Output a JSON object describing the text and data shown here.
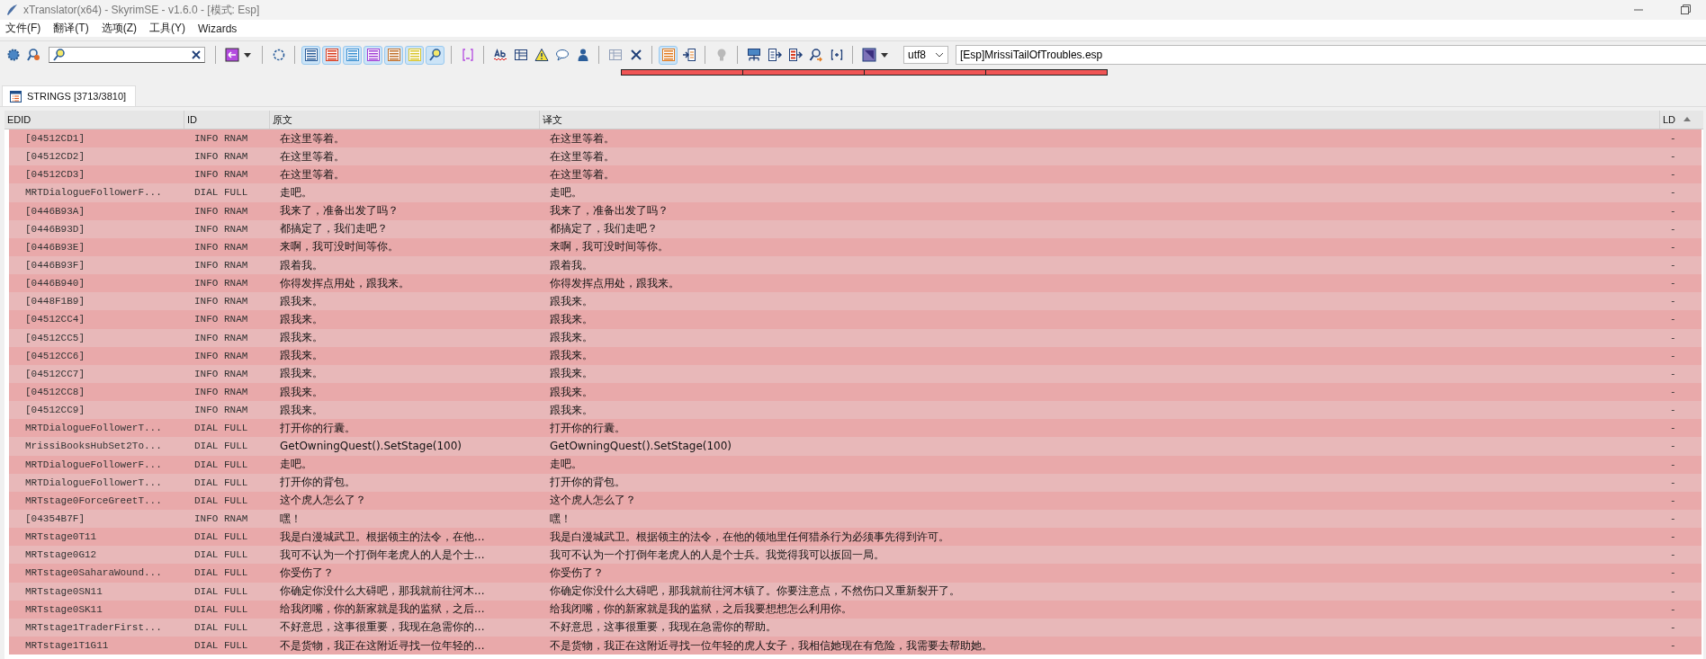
{
  "window": {
    "title": "xTranslator(x64) - SkyrimSE - v1.6.0 - [模式: Esp]"
  },
  "menu": [
    "文件(F)",
    "翻译(T)",
    "选项(Z)",
    "工具(Y)",
    "Wizards"
  ],
  "toolbar": [
    {
      "kind": "gear"
    },
    {
      "kind": "find"
    },
    {
      "kind": "search"
    },
    {
      "kind": "sep"
    },
    {
      "kind": "back"
    },
    {
      "kind": "caret"
    },
    {
      "kind": "sep"
    },
    {
      "kind": "ring"
    },
    {
      "kind": "sep"
    },
    {
      "kind": "list",
      "color": "#2a5d9a",
      "pressed": true
    },
    {
      "kind": "list",
      "color": "#d8391c",
      "pressed": true
    },
    {
      "kind": "list",
      "color": "#3a8fd0",
      "pressed": true
    },
    {
      "kind": "list",
      "color": "#a13fd6",
      "pressed": true
    },
    {
      "kind": "list",
      "color": "#c0702a",
      "pressed": true
    },
    {
      "kind": "list",
      "color": "#d9c62c",
      "pressed": true
    },
    {
      "kind": "lens",
      "pressed": true
    },
    {
      "kind": "sep"
    },
    {
      "kind": "brackets"
    },
    {
      "kind": "sep"
    },
    {
      "kind": "spell"
    },
    {
      "kind": "table"
    },
    {
      "kind": "warning"
    },
    {
      "kind": "bubble"
    },
    {
      "kind": "person"
    },
    {
      "kind": "sep"
    },
    {
      "kind": "table",
      "disabled": true
    },
    {
      "kind": "cross"
    },
    {
      "kind": "sep"
    },
    {
      "kind": "list",
      "color": "#e07a1f",
      "pressed": true
    },
    {
      "kind": "import"
    },
    {
      "kind": "sep"
    },
    {
      "kind": "bulb",
      "disabled": true
    },
    {
      "kind": "sep"
    },
    {
      "kind": "network"
    },
    {
      "kind": "export"
    },
    {
      "kind": "export2"
    },
    {
      "kind": "findnext"
    },
    {
      "kind": "plus"
    },
    {
      "kind": "sep"
    },
    {
      "kind": "square"
    },
    {
      "kind": "caret"
    },
    {
      "kind": "select",
      "value": "utf8"
    },
    {
      "kind": "file",
      "value": "[Esp]MrissiTailOfTroubles.esp"
    }
  ],
  "progress": [
    {
      "level": 1
    },
    {
      "level": 1
    },
    {
      "level": 1
    },
    {
      "level": 1
    }
  ],
  "tabs": [
    {
      "label": "STRINGS [3713/3810]",
      "selected": true
    }
  ],
  "table": {
    "columns": [
      "EDID",
      "ID",
      "原文",
      "译文",
      "LD"
    ],
    "rows": [
      [
        "[04512CD1]",
        "INFO RNAM",
        "在这里等着。",
        "在这里等着。",
        "-"
      ],
      [
        "[04512CD2]",
        "INFO RNAM",
        "在这里等着。",
        "在这里等着。",
        "-"
      ],
      [
        "[04512CD3]",
        "INFO RNAM",
        "在这里等着。",
        "在这里等着。",
        "-"
      ],
      [
        "MRTDialogueFollowerF...",
        "DIAL FULL",
        "走吧。",
        "走吧。",
        "-"
      ],
      [
        "[0446B93A]",
        "INFO RNAM",
        "我来了，准备出发了吗？",
        "我来了，准备出发了吗？",
        "-"
      ],
      [
        "[0446B93D]",
        "INFO RNAM",
        "都搞定了，我们走吧？",
        "都搞定了，我们走吧？",
        "-"
      ],
      [
        "[0446B93E]",
        "INFO RNAM",
        "来啊，我可没时间等你。",
        "来啊，我可没时间等你。",
        "-"
      ],
      [
        "[0446B93F]",
        "INFO RNAM",
        "跟着我。",
        "跟着我。",
        "-"
      ],
      [
        "[0446B940]",
        "INFO RNAM",
        "你得发挥点用处，跟我来。",
        "你得发挥点用处，跟我来。",
        "-"
      ],
      [
        "[0448F1B9]",
        "INFO RNAM",
        "跟我来。",
        "跟我来。",
        "-"
      ],
      [
        "[04512CC4]",
        "INFO RNAM",
        "跟我来。",
        "跟我来。",
        "-"
      ],
      [
        "[04512CC5]",
        "INFO RNAM",
        "跟我来。",
        "跟我来。",
        "-"
      ],
      [
        "[04512CC6]",
        "INFO RNAM",
        "跟我来。",
        "跟我来。",
        "-"
      ],
      [
        "[04512CC7]",
        "INFO RNAM",
        "跟我来。",
        "跟我来。",
        "-"
      ],
      [
        "[04512CC8]",
        "INFO RNAM",
        "跟我来。",
        "跟我来。",
        "-"
      ],
      [
        "[04512CC9]",
        "INFO RNAM",
        "跟我来。",
        "跟我来。",
        "-"
      ],
      [
        "MRTDialogueFollowerT...",
        "DIAL FULL",
        "打开你的行囊。",
        "打开你的行囊。",
        "-"
      ],
      [
        "MrissiBooksHubSet2To...",
        "DIAL FULL",
        "GetOwningQuest().SetStage(100)",
        "GetOwningQuest().SetStage(100)",
        "-"
      ],
      [
        "MRTDialogueFollowerF...",
        "DIAL FULL",
        "走吧。",
        "走吧。",
        "-"
      ],
      [
        "MRTDialogueFollowerT...",
        "DIAL FULL",
        "打开你的背包。",
        "打开你的背包。",
        "-"
      ],
      [
        "MRTstage0ForceGreetT...",
        "DIAL FULL",
        "这个虎人怎么了？",
        "这个虎人怎么了？",
        "-"
      ],
      [
        "[04354B7F]",
        "INFO RNAM",
        "嘿！",
        "嘿！",
        "-"
      ],
      [
        "MRTstage0T11",
        "DIAL FULL",
        "我是白漫城武卫。根据领主的法令，在他...",
        "我是白漫城武卫。根据领主的法令，在他的领地里任何猎杀行为必须事先得到许可。",
        "-"
      ],
      [
        "MRTstage0G12",
        "DIAL FULL",
        "我可不认为一个打倒年老虎人的人是个士...",
        "我可不认为一个打倒年老虎人的人是个士兵。我觉得我可以扳回一局。",
        "-"
      ],
      [
        "MRTstage0SaharaWound...",
        "DIAL FULL",
        "你受伤了？",
        "你受伤了？",
        "-"
      ],
      [
        "MRTstage0SN11",
        "DIAL FULL",
        "你确定你没什么大碍吧，那我就前往河木...",
        "你确定你没什么大碍吧，那我就前往河木镇了。你要注意点，不然伤口又重新裂开了。",
        "-"
      ],
      [
        "MRTstage0SK11",
        "DIAL FULL",
        "给我闭嘴，你的新家就是我的监狱，之后...",
        "给我闭嘴，你的新家就是我的监狱，之后我要想想怎么利用你。",
        "-"
      ],
      [
        "MRTstage1TraderFirst...",
        "DIAL FULL",
        "不好意思，这事很重要，我现在急需你的...",
        "不好意思，这事很重要，我现在急需你的帮助。",
        "-"
      ],
      [
        "MRTstage1T1G11",
        "DIAL FULL",
        "不是货物，我正在这附近寻找一位年轻的...",
        "不是货物，我正在这附近寻找一位年轻的虎人女子，我相信她现在有危险，我需要去帮助她。",
        "-"
      ]
    ]
  }
}
